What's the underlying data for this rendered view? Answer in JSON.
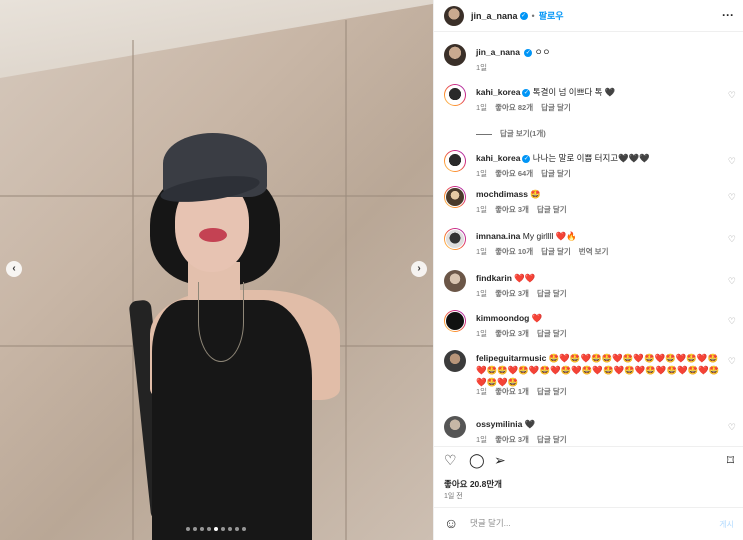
{
  "post": {
    "author": "jin_a_nana",
    "follow_label": "팔로우",
    "separator": "•",
    "more_label": "···",
    "caption_text": "ㅇㅇ",
    "caption_time": "1일"
  },
  "photo": {
    "prev_arrow": "‹",
    "next_arrow": "›",
    "carousel_count": 9,
    "carousel_active_index": 4
  },
  "comments": [
    {
      "user": "kahi_korea",
      "verified": true,
      "text": "톡결이 넘 이쁘다 톡 ",
      "emoji": "🖤",
      "time": "1일",
      "likes": "좋아요 82개",
      "reply": "답글 달기",
      "translate": ""
    },
    {
      "user": "kahi_korea",
      "verified": true,
      "text": "나나는 말로 이쁨 터지고",
      "emoji": "🖤🖤🖤",
      "time": "1일",
      "likes": "좋아요 64개",
      "reply": "답글 달기",
      "translate": ""
    },
    {
      "user": "mochdimass",
      "verified": false,
      "text": "",
      "emoji": "🤩",
      "time": "1일",
      "likes": "좋아요 3개",
      "reply": "답글 달기",
      "translate": ""
    },
    {
      "user": "imnana.ina",
      "verified": false,
      "text": "My girllll ",
      "emoji": "❤️🔥",
      "time": "1일",
      "likes": "좋아요 10개",
      "reply": "답글 달기",
      "translate": "번역 보기"
    },
    {
      "user": "findkarin",
      "verified": false,
      "text": "",
      "emoji": "❤️❤️",
      "time": "1일",
      "likes": "좋아요 3개",
      "reply": "답글 달기",
      "translate": ""
    },
    {
      "user": "kimmoondog",
      "verified": false,
      "text": "",
      "emoji": "❤️",
      "time": "1일",
      "likes": "좋아요 3개",
      "reply": "답글 달기",
      "translate": ""
    },
    {
      "user": "felipeguitarmusic",
      "verified": false,
      "text": "",
      "emoji": "🤩❤️🤩❤️🤩🤩❤️🤩❤️🤩❤️🤩❤️🤩❤️🤩❤️🤩🤩❤️🤩❤️🤩❤️🤩❤️🤩❤️🤩❤️🤩❤️🤩❤️🤩❤️🤩❤️🤩❤️🤩❤️🤩",
      "time": "1일",
      "likes": "좋아요 1개",
      "reply": "답글 달기",
      "translate": ""
    },
    {
      "user": "ossymilinia",
      "verified": false,
      "text": "",
      "emoji": "🖤",
      "time": "1일",
      "likes": "좋아요 3개",
      "reply": "답글 달기",
      "translate": ""
    }
  ],
  "replies_toggle": "답글 보기(1개)",
  "actions": {
    "likes": "좋아요 20.8만개",
    "posted": "1일 전"
  },
  "compose": {
    "placeholder": "댓글 달기...",
    "post_label": "게시"
  },
  "icons": {
    "heart": "heart-icon",
    "comment": "comment-icon",
    "share": "share-icon",
    "save": "bookmark-icon",
    "emoji": "emoji-icon"
  },
  "colors": {
    "accent": "#0095f6",
    "like_red": "#ed4956",
    "muted": "#737373"
  }
}
